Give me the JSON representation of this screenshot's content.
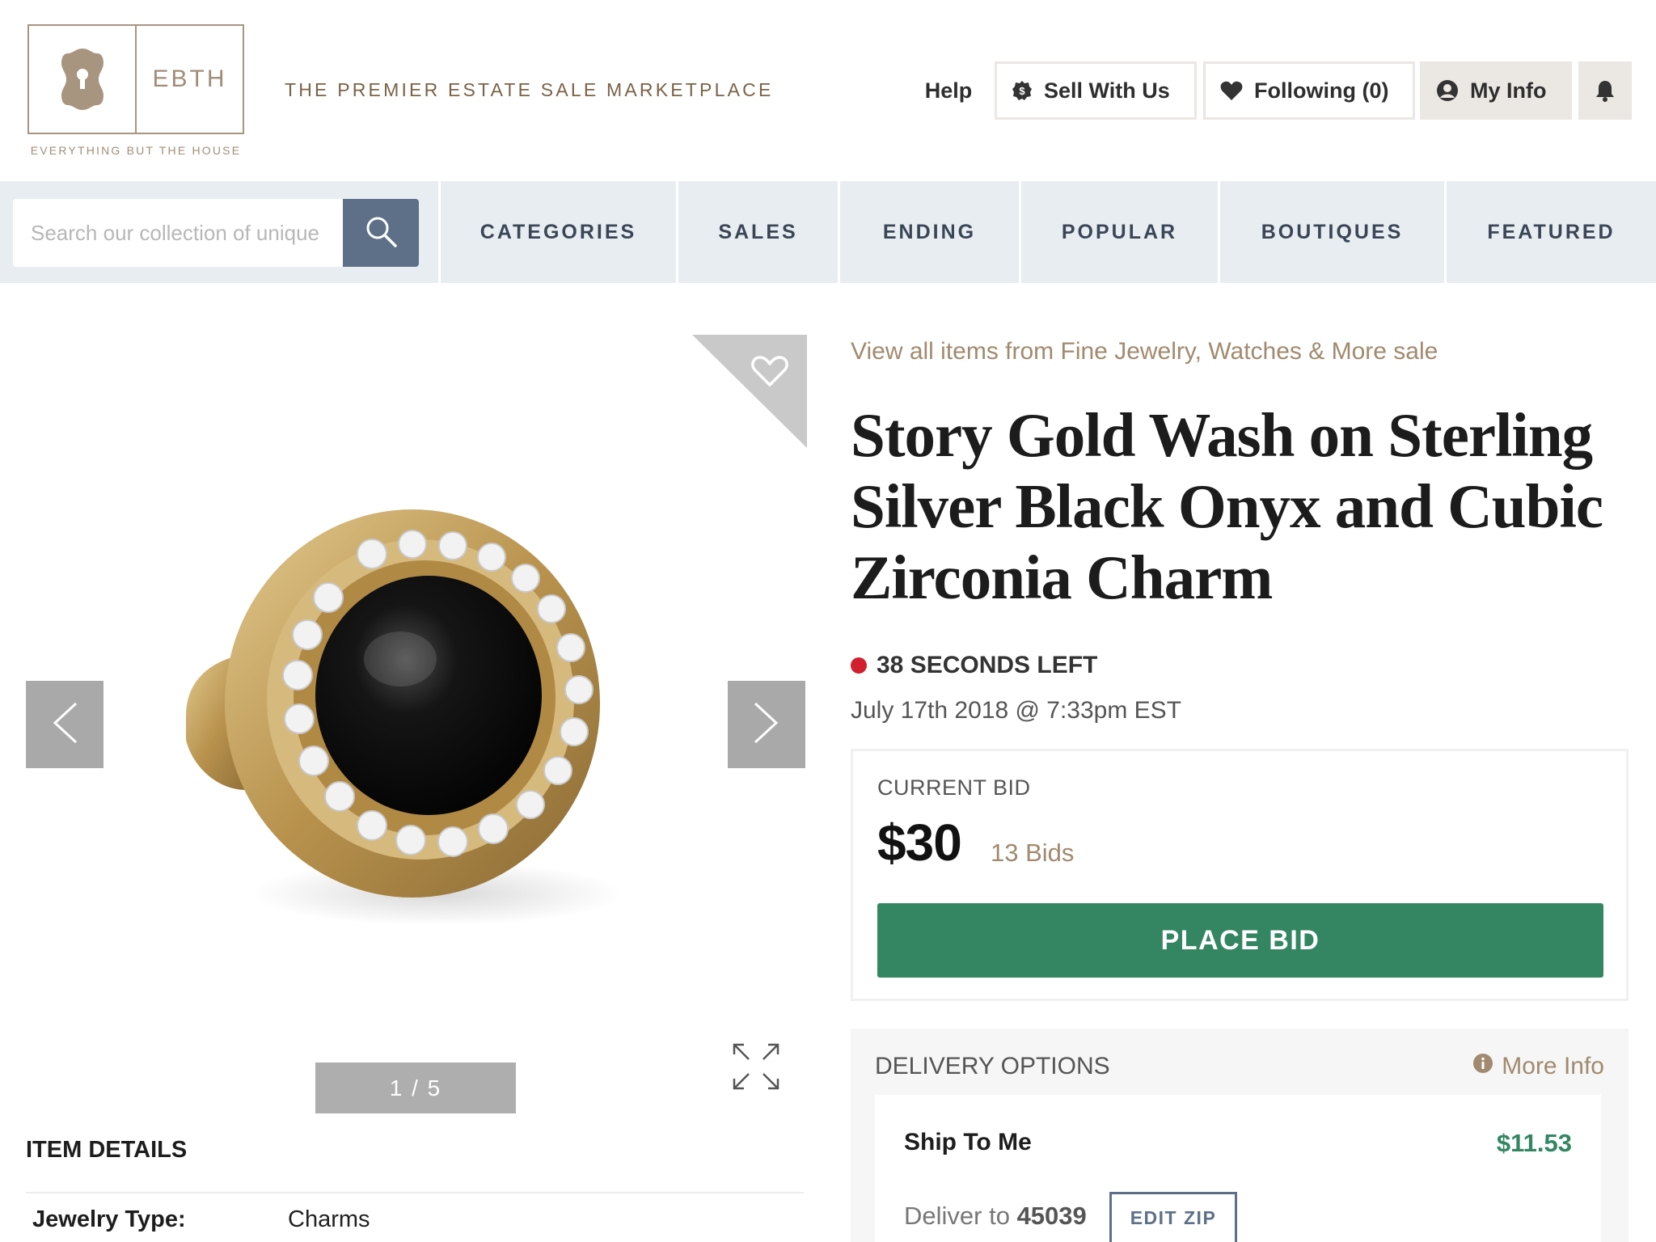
{
  "brand": {
    "wordmark": "EBTH",
    "subtitle": "EVERYTHING BUT THE HOUSE",
    "tagline": "THE PREMIER ESTATE SALE MARKETPLACE"
  },
  "header_nav": {
    "help": "Help",
    "sell": "Sell With Us",
    "following": "Following (0)",
    "my_info": "My Info"
  },
  "search": {
    "placeholder": "Search our collection of unique"
  },
  "nav_tabs": [
    "CATEGORIES",
    "SALES",
    "ENDING",
    "POPULAR",
    "BOUTIQUES",
    "FEATURED"
  ],
  "gallery": {
    "counter": "1 / 5"
  },
  "item": {
    "sale_link": "View all items from Fine Jewelry, Watches & More sale",
    "title": "Story Gold Wash on Sterling Silver Black Onyx and Cubic Zirconia Charm",
    "time_left": "38 SECONDS LEFT",
    "end_date": "July 17th 2018 @ 7:33pm EST"
  },
  "bid": {
    "label": "CURRENT BID",
    "amount": "$30",
    "count": "13 Bids",
    "button": "PLACE BID"
  },
  "delivery": {
    "title": "DELIVERY OPTIONS",
    "more_info": "More Info",
    "ship_label": "Ship To Me",
    "ship_price": "$11.53",
    "deliver_prefix": "Deliver to",
    "zip": "45039",
    "edit_zip": "EDIT ZIP"
  },
  "details": {
    "heading": "ITEM DETAILS",
    "rows": [
      {
        "label": "Jewelry Type:",
        "value": "Charms"
      }
    ]
  },
  "colors": {
    "brand_tan": "#a08e79",
    "nav_bg": "#e8edf2",
    "search_button": "#5e7088",
    "bid_green": "#348662",
    "timer_red": "#d0202e"
  }
}
